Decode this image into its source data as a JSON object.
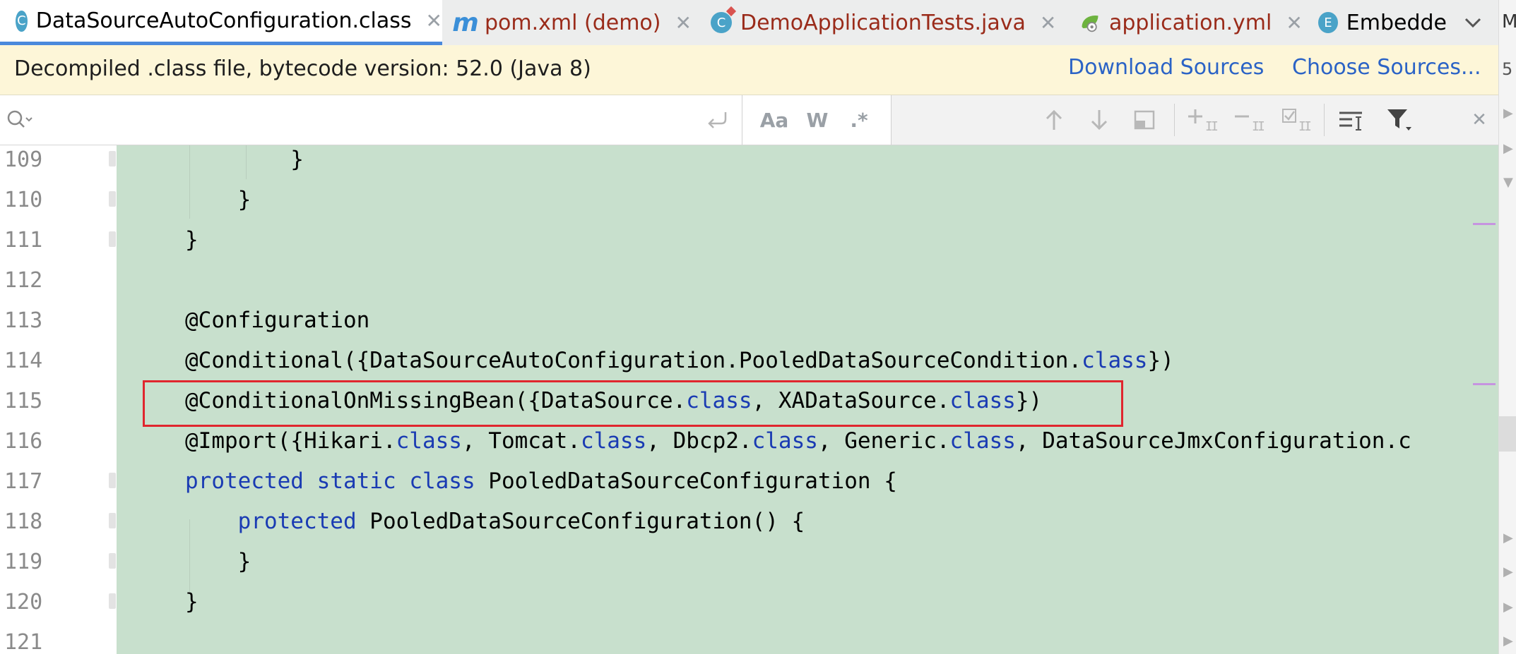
{
  "tabs": [
    {
      "label": "DataSourceAutoConfiguration.class",
      "icon": "class-icon",
      "icon_letter": "C",
      "active": true
    },
    {
      "label": "pom.xml (demo)",
      "icon": "maven-icon",
      "icon_letter": "m",
      "active": false
    },
    {
      "label": "DemoApplicationTests.java",
      "icon": "test-class-icon",
      "icon_letter": "C",
      "active": false
    },
    {
      "label": "application.yml",
      "icon": "spring-config-icon",
      "icon_letter": "",
      "active": false
    },
    {
      "label": "Embedde",
      "icon": "enum-icon",
      "icon_letter": "E",
      "active": false
    }
  ],
  "banner": {
    "text": "Decompiled .class file, bytecode version: 52.0 (Java 8)",
    "download_sources": "Download Sources",
    "choose_sources": "Choose Sources..."
  },
  "search": {
    "value": "",
    "placeholder": "",
    "tools": [
      "Aa",
      "W",
      ".*"
    ]
  },
  "right_strip": {
    "label": "M",
    "label_2": "5"
  },
  "code": {
    "lines": [
      {
        "num": "109",
        "text": "        }"
      },
      {
        "num": "110",
        "text": "    }"
      },
      {
        "num": "111",
        "text": "}"
      },
      {
        "num": "112",
        "text": ""
      },
      {
        "num": "113",
        "text": "@Configuration"
      },
      {
        "num": "114",
        "text": "@Conditional({DataSourceAutoConfiguration.PooledDataSourceCondition.class})"
      },
      {
        "num": "115",
        "text": "@ConditionalOnMissingBean({DataSource.class, XADataSource.class})"
      },
      {
        "num": "116",
        "text": "@Import({Hikari.class, Tomcat.class, Dbcp2.class, Generic.class, DataSourceJmxConfiguration.c"
      },
      {
        "num": "117",
        "text": "protected static class PooledDataSourceConfiguration {"
      },
      {
        "num": "118",
        "text": "    protected PooledDataSourceConfiguration() {"
      },
      {
        "num": "119",
        "text": "    }"
      },
      {
        "num": "120",
        "text": "}"
      },
      {
        "num": "121",
        "text": ""
      }
    ]
  },
  "colors": {
    "keyword": "#1a3bb3",
    "code_background": "#c8e0cd",
    "highlight_border": "#e0262e",
    "link": "#2b63c6",
    "banner_background": "#fdf6d8"
  }
}
